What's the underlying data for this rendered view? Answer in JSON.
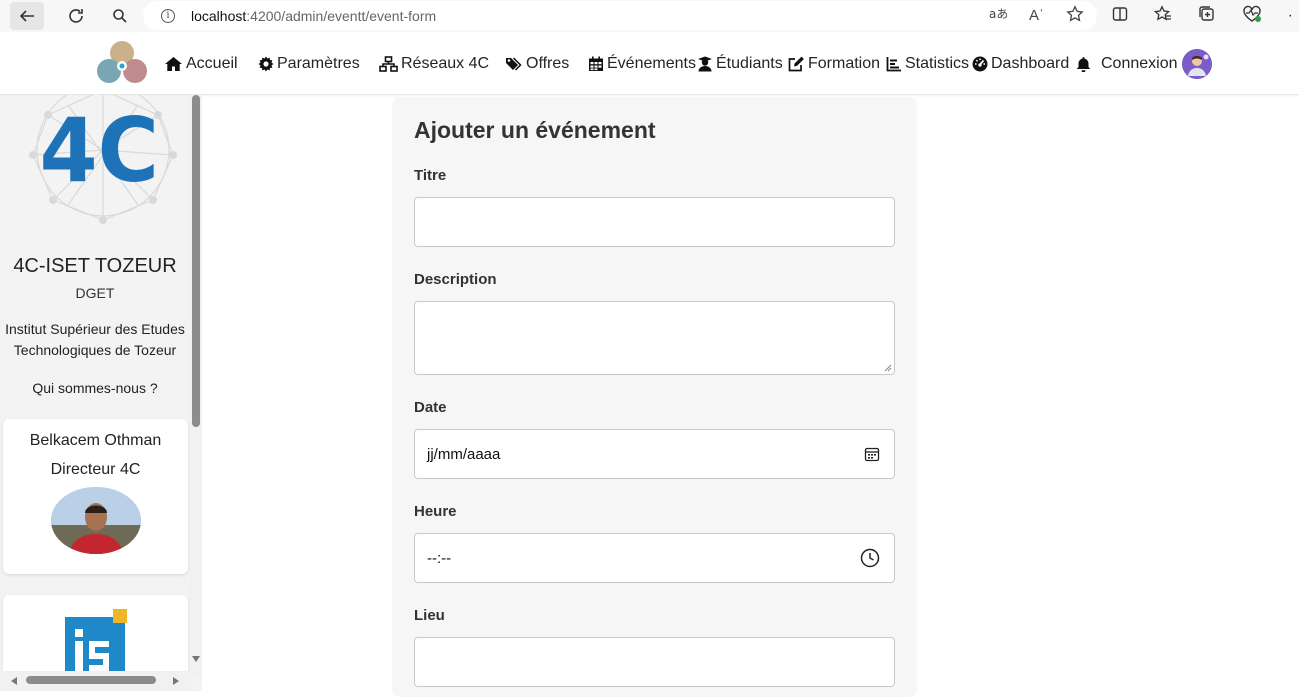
{
  "browser": {
    "url_host": "localhost",
    "url_path": ":4200/admin/eventt/event-form",
    "read_aloud_label": "Aʾ"
  },
  "navbar": {
    "items": [
      {
        "label": "Accueil",
        "icon": "home-icon"
      },
      {
        "label": "Paramètres",
        "icon": "gear-icon"
      },
      {
        "label": "Réseaux 4C",
        "icon": "network-icon"
      },
      {
        "label": "Offres",
        "icon": "tags-icon"
      },
      {
        "label": "Événements",
        "icon": "calendar-icon"
      },
      {
        "label": "Étudiants",
        "icon": "student-icon"
      },
      {
        "label": "Formation",
        "icon": "edit-icon"
      },
      {
        "label": "Statistics",
        "icon": "chart-icon"
      },
      {
        "label": "Dashboard",
        "icon": "gauge-icon"
      },
      {
        "label": "Connexion",
        "icon": "bell-icon"
      }
    ]
  },
  "sidebar": {
    "logo_text": "4C",
    "title": "4C-ISET TOZEUR",
    "subtitle": "DGET",
    "description_line1": "Institut Supérieur des Etudes",
    "description_line2": "Technologiques de Tozeur",
    "about_link": "Qui sommes-nous ?",
    "director": {
      "name": "Belkacem Othman",
      "role": "Directeur 4C"
    }
  },
  "form": {
    "title": "Ajouter un événement",
    "fields": [
      {
        "label": "Titre",
        "value": ""
      },
      {
        "label": "Description",
        "value": ""
      },
      {
        "label": "Date",
        "value": "jj/mm/aaaa"
      },
      {
        "label": "Heure",
        "value": "--:--"
      },
      {
        "label": "Lieu",
        "value": ""
      }
    ]
  },
  "colors": {
    "brand_blue": "#1e73b8",
    "avatar_purple": "#7b5cc9",
    "form_bg": "#f6f6f6",
    "sidebar_bg": "#f3f3f3"
  }
}
